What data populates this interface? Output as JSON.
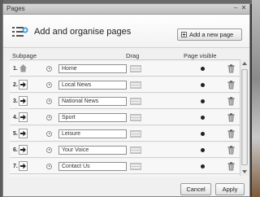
{
  "window": {
    "title": "Pages"
  },
  "header": {
    "title": "Add and organise pages",
    "add_button": "Add a new page"
  },
  "columns": {
    "subpage": "Subpage",
    "drag": "Drag",
    "visible": "Page visible"
  },
  "rows": [
    {
      "num": "1.",
      "name": "Home",
      "icon": "home-icon"
    },
    {
      "num": "2.",
      "name": "Local News",
      "icon": "arrow-icon"
    },
    {
      "num": "3.",
      "name": "National News",
      "icon": "arrow-icon"
    },
    {
      "num": "4.",
      "name": "Sport",
      "icon": "arrow-icon"
    },
    {
      "num": "5.",
      "name": "Leisure",
      "icon": "arrow-icon"
    },
    {
      "num": "6.",
      "name": "Your Voice",
      "icon": "arrow-icon"
    },
    {
      "num": "7.",
      "name": "Contact Us",
      "icon": "arrow-icon"
    }
  ],
  "footer": {
    "cancel": "Cancel",
    "apply": "Apply"
  }
}
